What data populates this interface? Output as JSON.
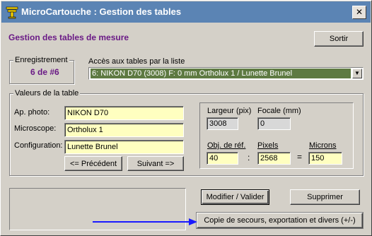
{
  "window": {
    "title": "MicroCartouche : Gestion des tables",
    "close_glyph": "✕"
  },
  "header": {
    "heading": "Gestion des tables de mesure",
    "exit_label": "Sortir"
  },
  "record": {
    "legend": "Enregistrement",
    "value": "6 de #6"
  },
  "table_access": {
    "label": "Accès aux tables par la liste",
    "selected": "6: NIKON D70  (3008)  F: 0 mm   Ortholux 1 / Lunette Brunel",
    "arrow_glyph": "▼"
  },
  "table_values": {
    "legend": "Valeurs de la table",
    "photo_label": "Ap. photo:",
    "photo_value": "NIKON D70",
    "microscope_label": "Microscope:",
    "microscope_value": "Ortholux 1",
    "config_label": "Configuration:",
    "config_value": "Lunette Brunel",
    "prev_label": "<= Précédent",
    "next_label": "Suivant =>",
    "width_label": "Largeur (pix)",
    "width_value": "3008",
    "focal_label": "Focale (mm)",
    "focal_value": "0",
    "objref_label": "Obj. de réf.",
    "objref_value": "40",
    "pixels_label": "Pixels",
    "pixels_value": "2568",
    "microns_label": "Microns",
    "microns_value": "150",
    "colon": ":",
    "equals": "="
  },
  "actions": {
    "modify_label": "Modifier / Valider",
    "delete_label": "Supprimer",
    "backup_label": "Copie de secours, exportation et divers (+/-)"
  },
  "colors": {
    "titlebar": "#5b84b4",
    "heading": "#6a1a86",
    "field": "#ffffc0",
    "selection": "#5e7a42",
    "arrow": "#1a1aff"
  }
}
